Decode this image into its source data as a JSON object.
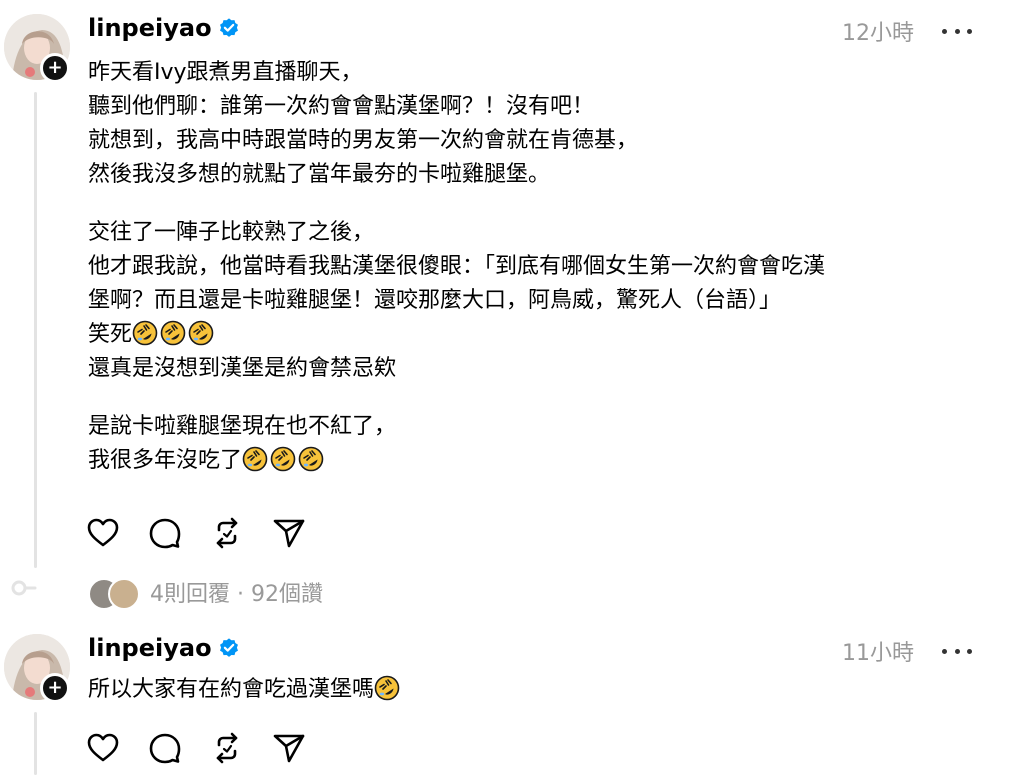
{
  "post1": {
    "username": "linpeiyao",
    "time": "12小時",
    "paragraphs": [
      [
        "昨天看Ivy跟煮男直播聊天，",
        "聽到他們聊：誰第一次約會會點漢堡啊？！沒有吧！",
        "就想到，我高中時跟當時的男友第一次約會就在肯德基，",
        "然後我沒多想的就點了當年最夯的卡啦雞腿堡。"
      ],
      [
        "交往了一陣子比較熟了之後，",
        "他才跟我說，他當時看我點漢堡很傻眼：「到底有哪個女生第一次約會會吃漢",
        "堡啊？而且還是卡啦雞腿堡！還咬那麼大口，阿鳥威，驚死人（台語）」",
        "笑死",
        "還真是沒想到漢堡是約會禁忌欸"
      ],
      [
        "是說卡啦雞腿堡現在也不紅了，",
        "我很多年沒吃了"
      ]
    ],
    "replies_summary": "4則回覆 · 92個讚"
  },
  "post2": {
    "username": "linpeiyao",
    "time": "11小時",
    "text": "所以大家有在約會吃過漢堡嗎"
  },
  "icons": {
    "like": "heart-icon",
    "comment": "comment-icon",
    "repost": "repost-icon",
    "share": "send-icon",
    "verified": "verified-badge-icon",
    "more": "more-dots-icon",
    "emoji": "rolling-on-floor-laughing-emoji"
  },
  "colors": {
    "verified": "#0095f6",
    "muted": "#999999",
    "thread_line": "#e3e3e3"
  }
}
